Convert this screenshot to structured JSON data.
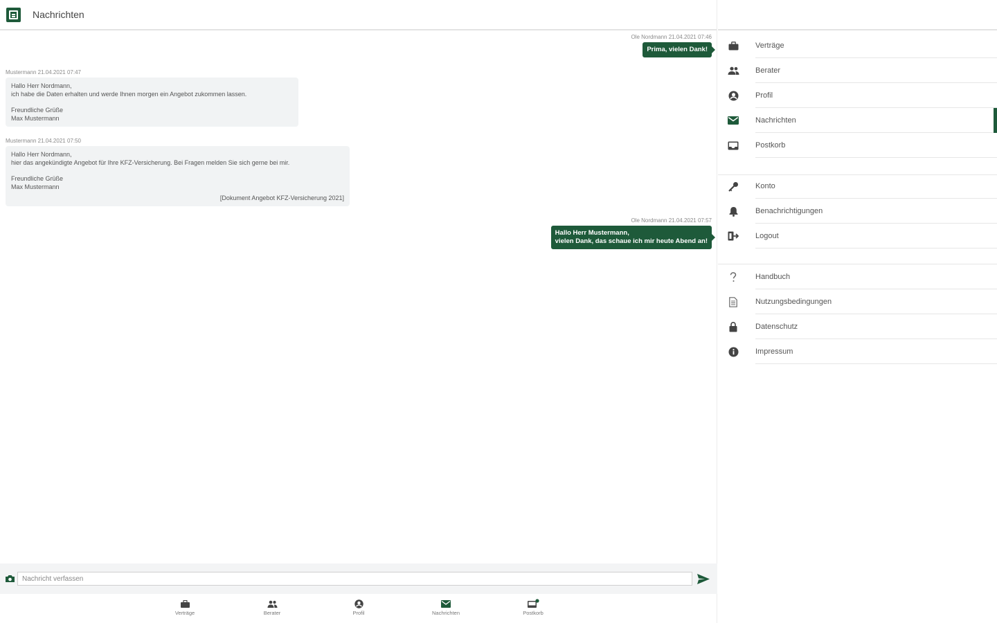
{
  "header": {
    "title": "Nachrichten"
  },
  "messages": [
    {
      "direction": "out",
      "meta": "Ole Nordmann 21.04.2021 07:46",
      "lines": [
        "Prima, vielen Dank!"
      ]
    },
    {
      "direction": "in",
      "meta": "Mustermann 21.04.2021 07:47",
      "lines": [
        "Hallo Herr Nordmann,",
        "ich habe die Daten erhalten und werde Ihnen morgen ein Angebot zukommen lassen."
      ],
      "signature": [
        "Freundliche Grüße",
        "Max Mustermann"
      ]
    },
    {
      "direction": "in",
      "meta": "Mustermann 21.04.2021 07:50",
      "lines": [
        "Hallo Herr Nordmann,",
        "hier das angekündigte Angebot für Ihre KFZ-Versicherung. Bei Fragen melden Sie sich gerne bei mir."
      ],
      "signature": [
        "Freundliche Grüße",
        "Max Mustermann"
      ],
      "attachment": "[Dokument Angebot KFZ-Versicherung 2021]"
    },
    {
      "direction": "out",
      "meta": "Ole Nordmann 21.04.2021 07:57",
      "lines": [
        "Hallo Herr Mustermann,",
        "vielen Dank, das schaue ich mir heute Abend an!"
      ]
    }
  ],
  "composer": {
    "placeholder": "Nachricht verfassen"
  },
  "bottom_nav": [
    {
      "label": "Verträge",
      "icon": "briefcase-icon"
    },
    {
      "label": "Berater",
      "icon": "people-icon"
    },
    {
      "label": "Profil",
      "icon": "account-icon"
    },
    {
      "label": "Nachrichten",
      "icon": "mail-icon",
      "active": true
    },
    {
      "label": "Postkorb",
      "icon": "inbox-icon",
      "badge": true
    }
  ],
  "sidebar": {
    "group1": [
      {
        "label": "Verträge",
        "icon": "briefcase-icon"
      },
      {
        "label": "Berater",
        "icon": "people-icon"
      },
      {
        "label": "Profil",
        "icon": "account-icon"
      },
      {
        "label": "Nachrichten",
        "icon": "mail-icon",
        "active": true
      },
      {
        "label": "Postkorb",
        "icon": "inbox-icon"
      }
    ],
    "group2": [
      {
        "label": "Konto",
        "icon": "key-icon"
      },
      {
        "label": "Benachrichtigungen",
        "icon": "bell-icon"
      },
      {
        "label": "Logout",
        "icon": "logout-icon"
      }
    ],
    "group3": [
      {
        "label": "Handbuch",
        "icon": "help-icon"
      },
      {
        "label": "Nutzungsbedingungen",
        "icon": "document-icon"
      },
      {
        "label": "Datenschutz",
        "icon": "lock-icon"
      },
      {
        "label": "Impressum",
        "icon": "info-icon"
      }
    ]
  },
  "colors": {
    "brand": "#1e5a3a",
    "incoming_bubble": "#f1f3f4",
    "icon": "#444444"
  }
}
